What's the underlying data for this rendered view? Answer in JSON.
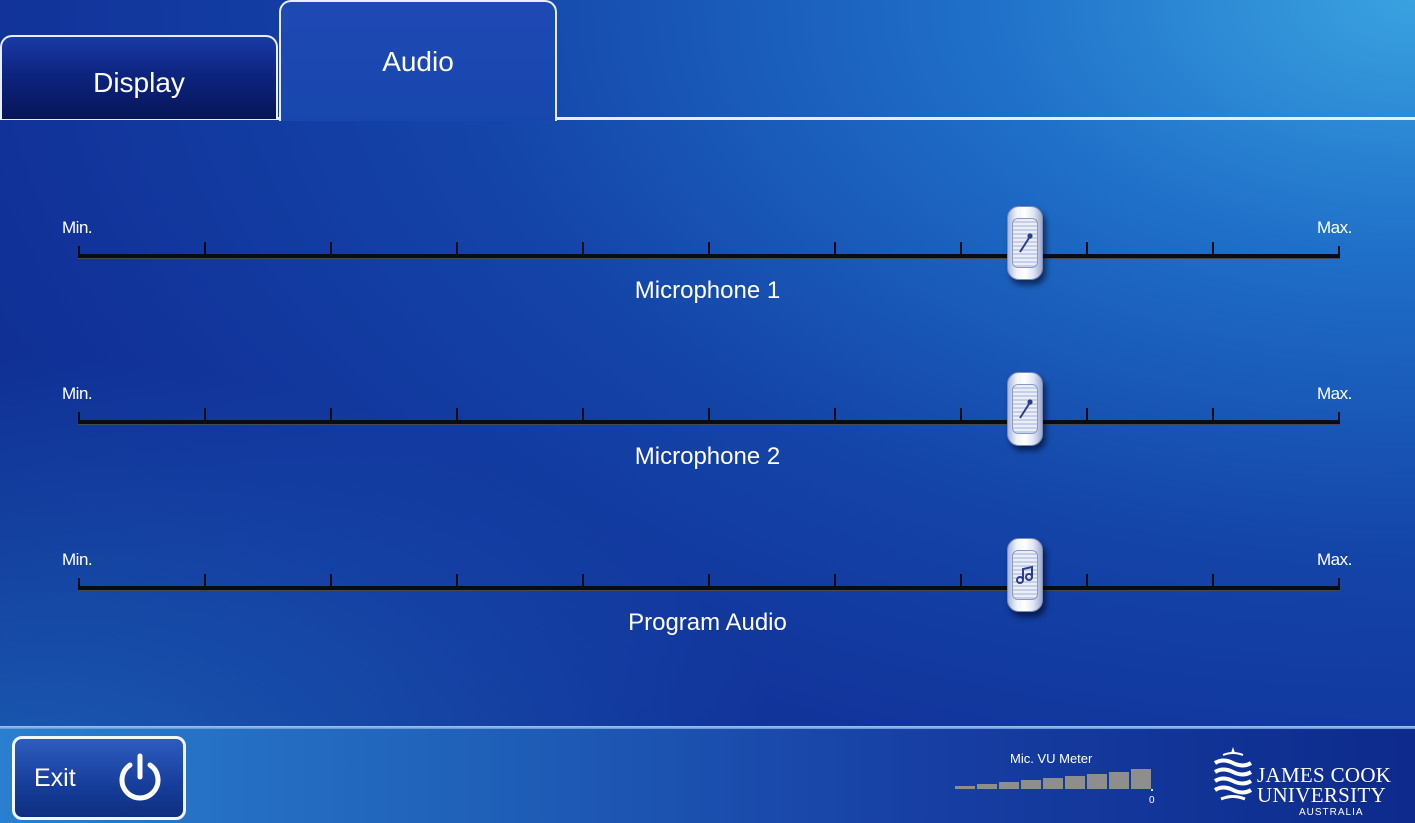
{
  "tabs": [
    {
      "label": "Display",
      "active": false
    },
    {
      "label": "Audio",
      "active": true
    }
  ],
  "sliders": [
    {
      "name": "Microphone 1",
      "min_label": "Min.",
      "max_label": "Max.",
      "level_fraction": 0.75,
      "knob_icon": "microphone-icon"
    },
    {
      "name": "Microphone 2",
      "min_label": "Min.",
      "max_label": "Max.",
      "level_fraction": 0.75,
      "knob_icon": "microphone-icon"
    },
    {
      "name": "Program Audio",
      "min_label": "Min.",
      "max_label": "Max.",
      "level_fraction": 0.75,
      "knob_icon": "music-notes-icon"
    }
  ],
  "exit": {
    "label": "Exit",
    "icon": "power-icon"
  },
  "vu_meter": {
    "title": "Mic. VU Meter",
    "zero_label": "0",
    "segments": 9
  },
  "logo": {
    "line1": "JAMES COOK",
    "line2": "UNIVERSITY",
    "line3": "AUSTRALIA"
  },
  "colors": {
    "accent_dark": "#0c2684",
    "accent_light": "#3aa2e0",
    "tab_border": "#e8eef8"
  }
}
